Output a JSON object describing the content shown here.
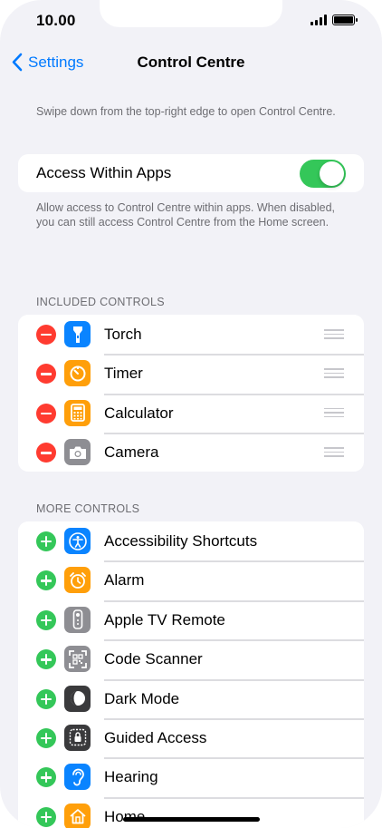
{
  "status_bar": {
    "time": "10.00"
  },
  "nav": {
    "back_label": "Settings",
    "title": "Control Centre"
  },
  "intro_text": "Swipe down from the top-right edge to open Control Centre.",
  "access_within_apps": {
    "label": "Access Within Apps",
    "enabled": true,
    "footer": "Allow access to Control Centre within apps. When disabled, you can still access Control Centre from the Home screen."
  },
  "included_controls": {
    "header": "INCLUDED CONTROLS",
    "items": [
      {
        "label": "Torch",
        "icon": "torch-icon",
        "color": "#0a84ff"
      },
      {
        "label": "Timer",
        "icon": "timer-icon",
        "color": "#ff9f0a"
      },
      {
        "label": "Calculator",
        "icon": "calculator-icon",
        "color": "#ff9f0a"
      },
      {
        "label": "Camera",
        "icon": "camera-icon",
        "color": "#8e8e93"
      }
    ]
  },
  "more_controls": {
    "header": "MORE CONTROLS",
    "items": [
      {
        "label": "Accessibility Shortcuts",
        "icon": "accessibility-icon",
        "color": "#0a84ff"
      },
      {
        "label": "Alarm",
        "icon": "alarm-icon",
        "color": "#ff9f0a"
      },
      {
        "label": "Apple TV Remote",
        "icon": "tv-remote-icon",
        "color": "#8e8e93"
      },
      {
        "label": "Code Scanner",
        "icon": "code-scanner-icon",
        "color": "#8e8e93"
      },
      {
        "label": "Dark Mode",
        "icon": "dark-mode-icon",
        "color": "#3a3a3c"
      },
      {
        "label": "Guided Access",
        "icon": "guided-access-icon",
        "color": "#3a3a3c"
      },
      {
        "label": "Hearing",
        "icon": "hearing-icon",
        "color": "#0a84ff"
      },
      {
        "label": "Home",
        "icon": "home-icon",
        "color": "#ff9f0a"
      }
    ]
  },
  "colors": {
    "accent": "#007aff",
    "remove": "#ff3b30",
    "add": "#34c759",
    "background": "#f2f2f7"
  }
}
